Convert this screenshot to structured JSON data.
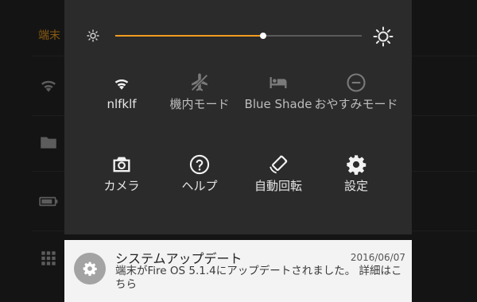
{
  "background": {
    "device_label": "端末"
  },
  "brightness": {
    "level": 0.6
  },
  "tiles": [
    {
      "label": "nlfklf",
      "icon": "wifi-icon",
      "state": "on"
    },
    {
      "label": "機内モード",
      "icon": "airplane-off-icon",
      "state": "off"
    },
    {
      "label": "Blue Shade",
      "icon": "bed-icon",
      "state": "off"
    },
    {
      "label": "おやすみモード",
      "icon": "do-not-disturb-icon",
      "state": "off"
    },
    {
      "label": "カメラ",
      "icon": "camera-icon",
      "state": "on"
    },
    {
      "label": "ヘルプ",
      "icon": "help-icon",
      "state": "on"
    },
    {
      "label": "自動回転",
      "icon": "auto-rotate-icon",
      "state": "on"
    },
    {
      "label": "設定",
      "icon": "gear-icon",
      "state": "on"
    }
  ],
  "notification": {
    "title": "システムアップデート",
    "date": "2016/06/07",
    "body": "端末がFire OS 5.1.4にアップデートされました。 詳細はこちら"
  },
  "colors": {
    "accent": "#f29c1f",
    "panel": "#2b2b2b",
    "card": "#f3f3f3"
  }
}
